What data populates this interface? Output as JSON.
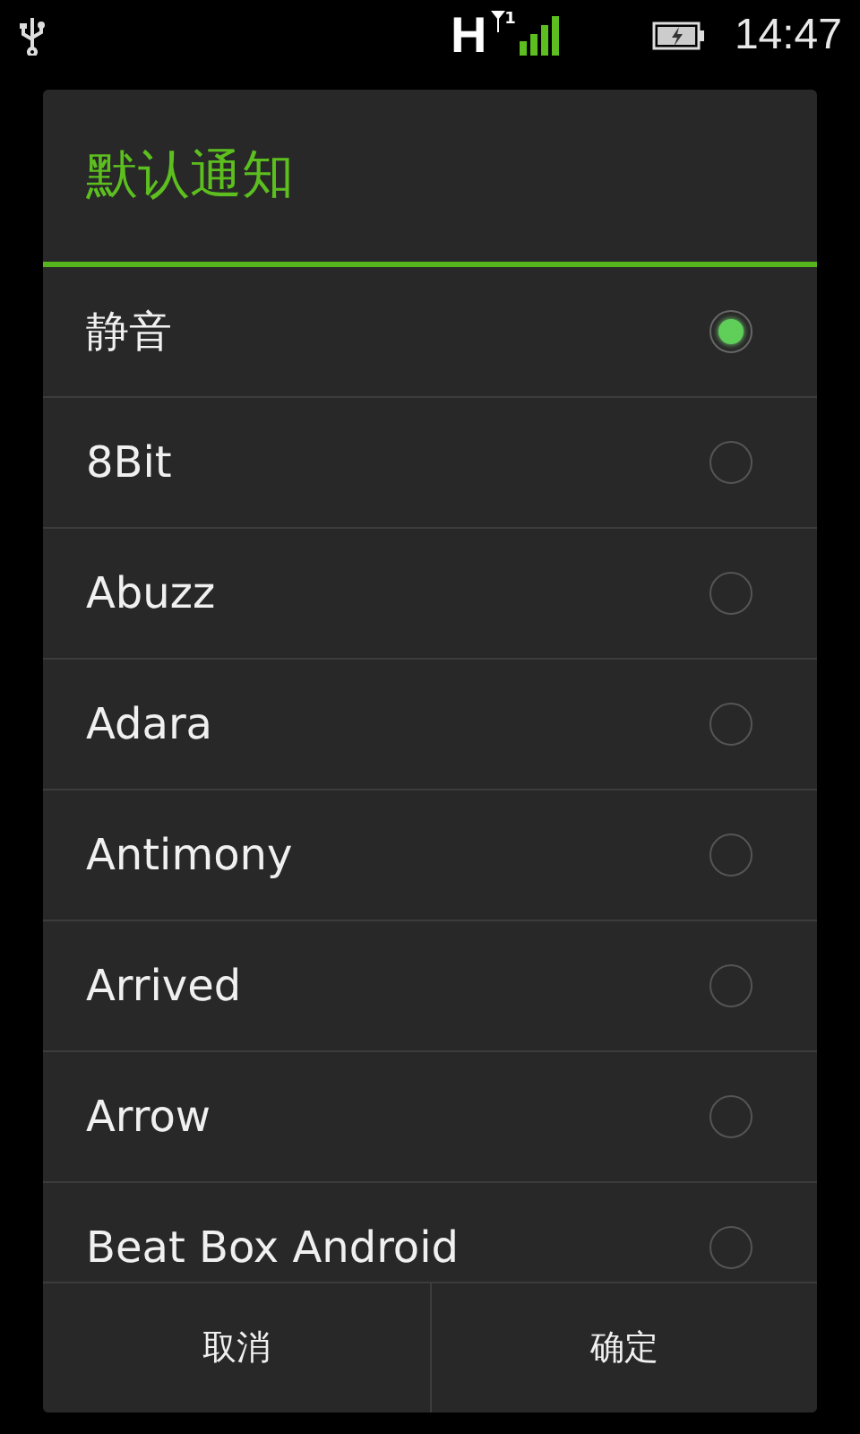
{
  "status_bar": {
    "network": "H",
    "sim": "1",
    "time": "14:47"
  },
  "dialog": {
    "title": "默认通知",
    "options": [
      {
        "label": "静音",
        "selected": true
      },
      {
        "label": "8Bit",
        "selected": false
      },
      {
        "label": "Abuzz",
        "selected": false
      },
      {
        "label": "Adara",
        "selected": false
      },
      {
        "label": "Antimony",
        "selected": false
      },
      {
        "label": "Arrived",
        "selected": false
      },
      {
        "label": "Arrow",
        "selected": false
      },
      {
        "label": "Beat Box Android",
        "selected": false
      }
    ],
    "buttons": [
      "取消",
      "确定"
    ]
  }
}
